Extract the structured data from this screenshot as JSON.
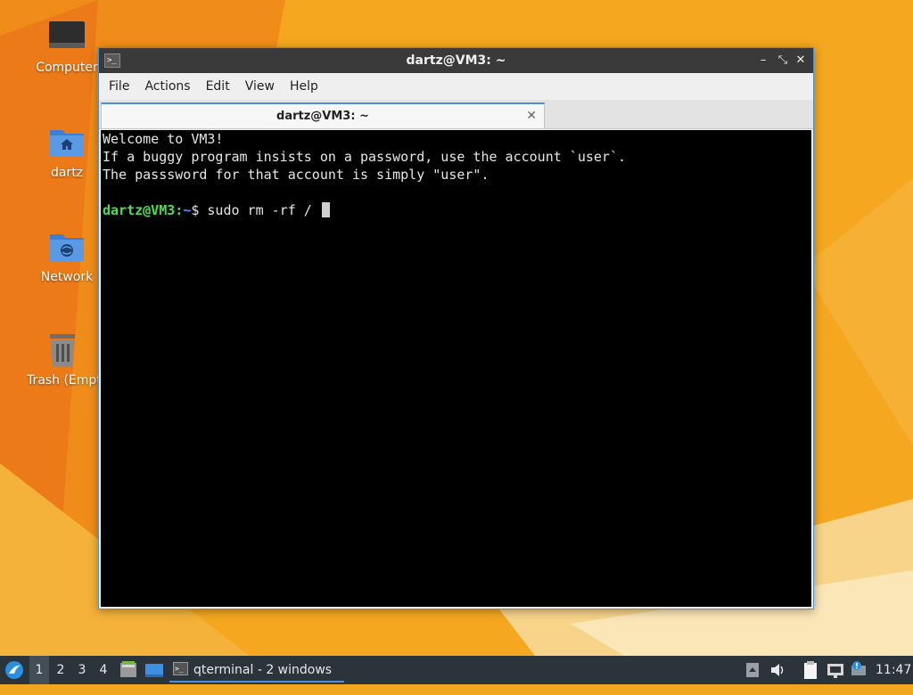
{
  "desktop": {
    "icons": [
      {
        "label": "Computer",
        "icon": "computer-icon"
      },
      {
        "label": "dartz",
        "icon": "home-folder-icon"
      },
      {
        "label": "Network",
        "icon": "network-folder-icon"
      },
      {
        "label": "Trash (Empty)",
        "icon": "trash-icon"
      }
    ]
  },
  "window": {
    "title": "dartz@VM3: ~",
    "controls": {
      "minimize": "–",
      "maximize": "⤡",
      "close": "✕"
    },
    "menu": [
      "File",
      "Actions",
      "Edit",
      "View",
      "Help"
    ],
    "tab": {
      "title": "dartz@VM3: ~",
      "close": "✕"
    },
    "terminal": {
      "lines": [
        "Welcome to VM3!",
        "If a buggy program insists on a password, use the account `user`.",
        "The passsword for that account is simply \"user\"."
      ],
      "prompt_user": "dartz@VM3",
      "prompt_sep": ":",
      "prompt_path": "~",
      "prompt_symbol": "$",
      "command": " sudo rm -rf / "
    }
  },
  "taskbar": {
    "workspaces": [
      "1",
      "2",
      "3",
      "4"
    ],
    "task_label": "qterminal - 2 windows",
    "clock": "11:47"
  },
  "colors": {
    "accent": "#4a90d9",
    "prompt_user": "#4ee04e",
    "prompt_path": "#5c8dff",
    "taskbar_bg": "#2b333b"
  }
}
